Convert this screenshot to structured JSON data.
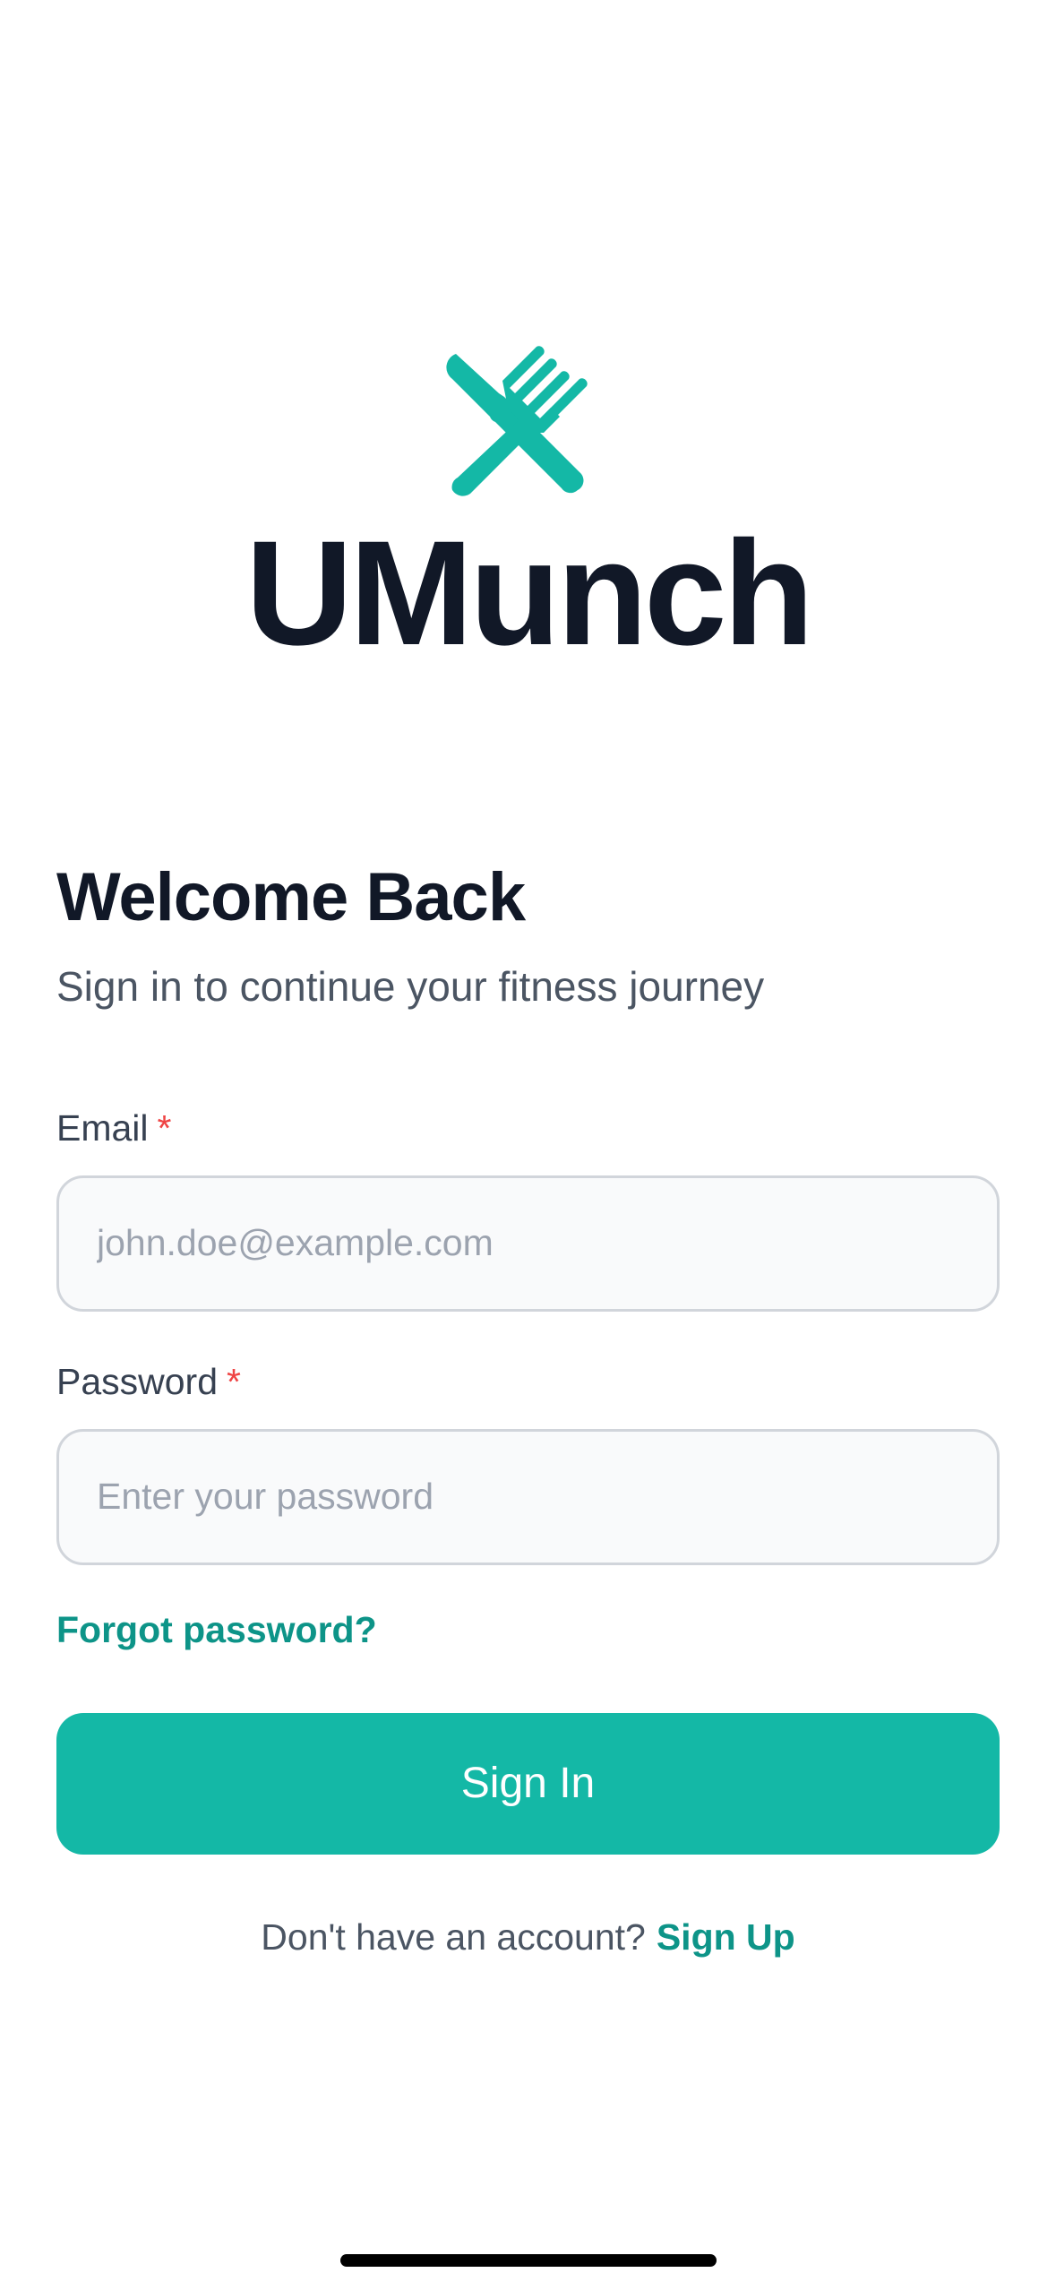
{
  "app": {
    "name": "UMunch",
    "logo_icon": "fork-knife-icon",
    "accent_color": "#14b8a6"
  },
  "header": {
    "title": "Welcome Back",
    "subtitle": "Sign in to continue your fitness journey"
  },
  "form": {
    "email": {
      "label": "Email",
      "required_marker": "*",
      "value": "",
      "placeholder": "john.doe@example.com"
    },
    "password": {
      "label": "Password",
      "required_marker": "*",
      "value": "",
      "placeholder": "Enter your password"
    },
    "forgot_label": "Forgot password?",
    "submit_label": "Sign In"
  },
  "footer": {
    "prompt": "Don't have an account?",
    "signup_label": "Sign Up"
  }
}
